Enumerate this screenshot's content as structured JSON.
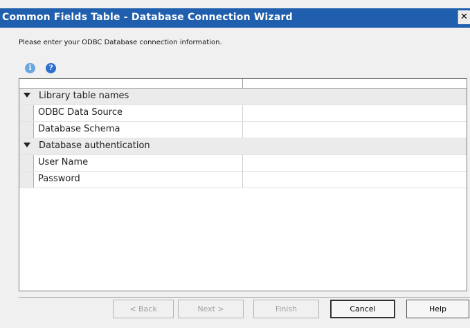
{
  "window": {
    "title": "Common Fields Table - Database Connection Wizard",
    "close_glyph": "✕"
  },
  "instruction": "Please enter your ODBC Database connection information.",
  "toolbar": {
    "icons": [
      "info-icon",
      "help-icon"
    ],
    "info_glyph": "i",
    "help_glyph": "?"
  },
  "grid": {
    "categories": [
      {
        "label": "Library table names",
        "properties": [
          {
            "name": "ODBC Data Source",
            "value": ""
          },
          {
            "name": "Database Schema",
            "value": ""
          }
        ]
      },
      {
        "label": "Database authentication",
        "properties": [
          {
            "name": "User Name",
            "value": ""
          },
          {
            "name": "Password",
            "value": ""
          }
        ]
      }
    ]
  },
  "buttons": {
    "back": "< Back",
    "next": "Next >",
    "finish": "Finish",
    "cancel": "Cancel",
    "help": "Help"
  },
  "colors": {
    "titlebar": "#1f5fae",
    "info": "#6aa6e0",
    "help": "#2f6fcf"
  }
}
